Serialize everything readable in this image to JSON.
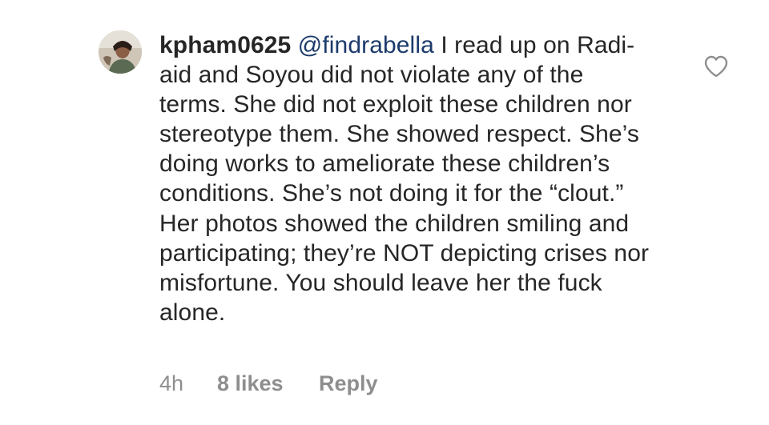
{
  "comment": {
    "username": "kpham0625",
    "mention": "@findrabella",
    "text": "I read up on Radi-aid and Soyou did not violate any of the terms. She did not exploit these children nor stereotype them. She showed respect. She’s doing works to ameliorate these children’s conditions. She’s not doing it for the “clout.” Her photos showed the children smiling and participating; they’re NOT depicting crises nor misfortune. You should leave her the fuck alone.",
    "time": "4h",
    "likes": "8 likes",
    "reply_label": "Reply"
  },
  "icons": {
    "avatar": "profile-photo",
    "like": "heart-outline-icon"
  },
  "colors": {
    "text": "#262626",
    "mention": "#1c3a6b",
    "meta": "#8e8e8e",
    "background": "#ffffff"
  }
}
